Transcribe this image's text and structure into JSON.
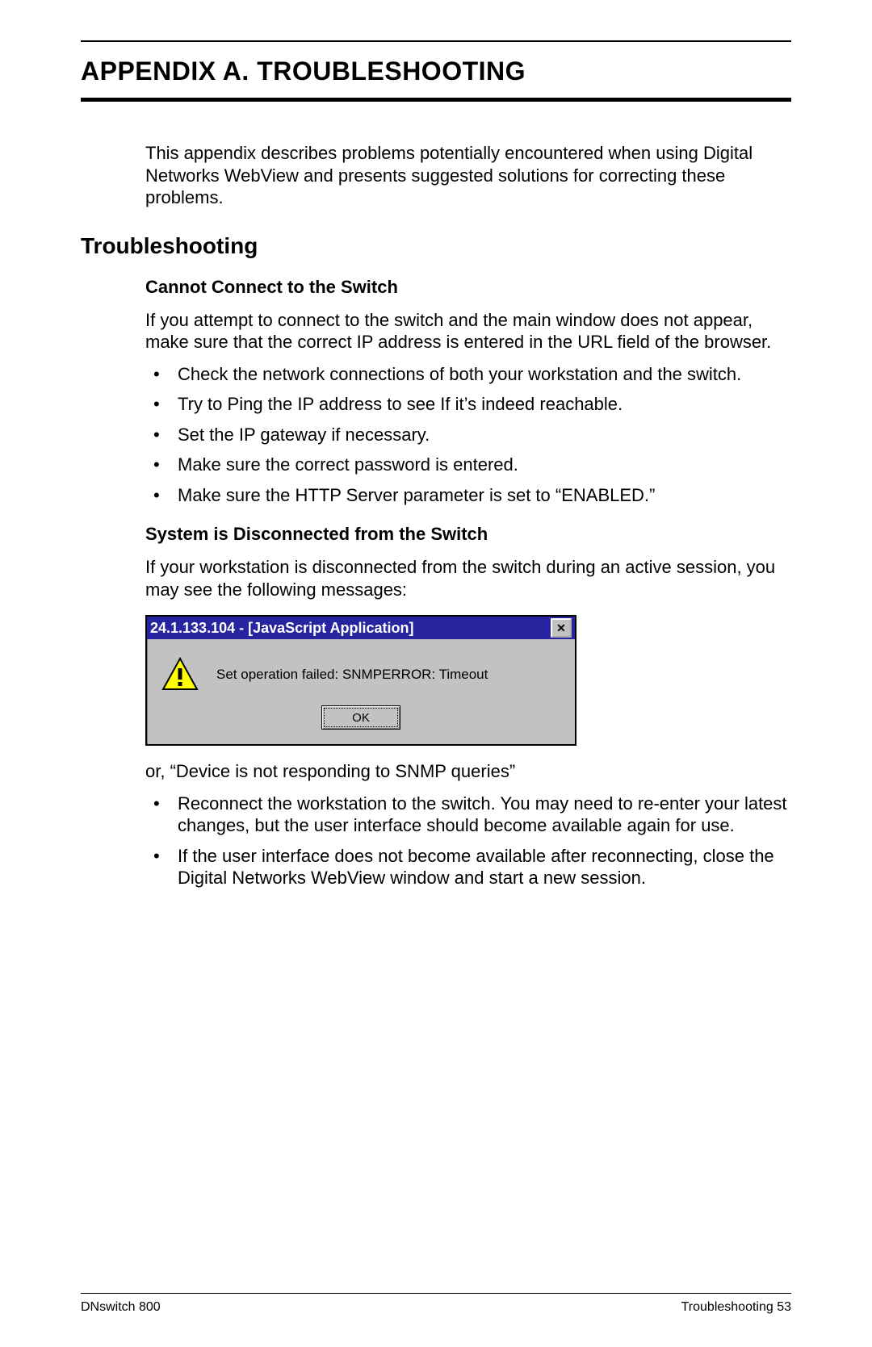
{
  "appendix_title": "APPENDIX A.  TROUBLESHOOTING",
  "intro": "This appendix describes problems potentially encountered when using Digital Networks WebView and presents suggested solutions for correcting these problems.",
  "section_title": "Troubleshooting",
  "sub1": {
    "title": "Cannot Connect to the Switch",
    "para": "If you attempt to connect to the switch and the main window does not appear, make sure that the correct IP address is entered in the URL field of the browser.",
    "bullets": [
      "Check the network connections of both your workstation and the switch.",
      "Try to Ping the IP address to see If it’s indeed reachable.",
      "Set the IP gateway if necessary.",
      "Make sure the correct password is entered.",
      "Make sure the HTTP Server parameter is set to “ENABLED.”"
    ]
  },
  "sub2": {
    "title": "System is Disconnected from the Switch",
    "para": "If your workstation is disconnected from the switch during an active session, you may see the following messages:",
    "dialog": {
      "title": "24.1.133.104 - [JavaScript Application]",
      "close_glyph": "✕",
      "message": "Set operation failed: SNMPERROR: Timeout",
      "ok_label": "OK"
    },
    "after": "or, “Device is not responding to SNMP queries”",
    "bullets": [
      "Reconnect the workstation to the switch. You may need to re-enter your latest changes, but the user interface should become available again for use.",
      "If the user interface does not become available after reconnecting, close the Digital Networks WebView window and start a new session."
    ]
  },
  "footer": {
    "left": "DNswitch 800",
    "right": "Troubleshooting  53"
  }
}
